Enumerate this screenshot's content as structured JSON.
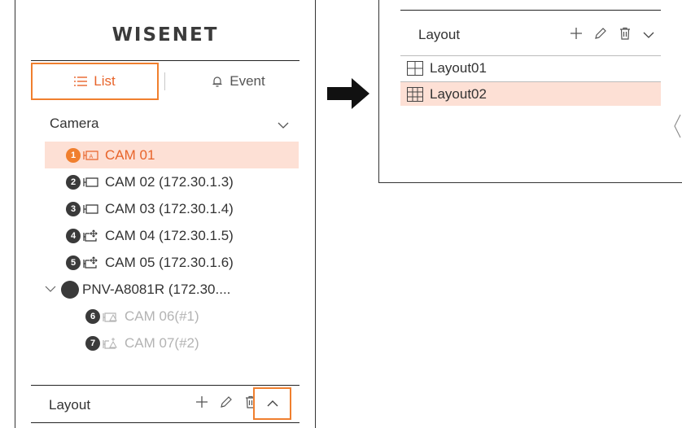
{
  "left_panel": {
    "logo": "WISENET",
    "tabs": [
      {
        "label": "List",
        "icon": "list-icon",
        "active": true
      },
      {
        "label": "Event",
        "icon": "bell-icon",
        "active": false
      }
    ],
    "camera_section": {
      "title": "Camera"
    },
    "cameras": [
      {
        "badge": "1",
        "label": "CAM 01",
        "selected": true
      },
      {
        "badge": "2",
        "label": "CAM 02 (172.30.1.3)"
      },
      {
        "badge": "3",
        "label": "CAM 03 (172.30.1.4)"
      },
      {
        "badge": "4",
        "label": "CAM 04 (172.30.1.5)"
      },
      {
        "badge": "5",
        "label": "CAM 05 (172.30.1.6)"
      },
      {
        "label": "PNV-A8081R (172.30...."
      },
      {
        "badge": "6",
        "label": "CAM 06(#1)",
        "disabled": true
      },
      {
        "badge": "7",
        "label": "CAM 07(#2)",
        "disabled": true
      }
    ],
    "layout_section": {
      "title": "Layout"
    }
  },
  "right_panel": {
    "layout_section": {
      "title": "Layout"
    },
    "layouts": [
      {
        "label": "Layout01",
        "icon": "grid-2x2-icon"
      },
      {
        "label": "Layout02",
        "icon": "grid-3x3-icon",
        "selected": true
      }
    ]
  },
  "colors": {
    "accent": "#f07f2e",
    "selected_bg": "#fde0d5",
    "selected_text": "#e8642a",
    "disabled_text": "#b3b3b3"
  }
}
